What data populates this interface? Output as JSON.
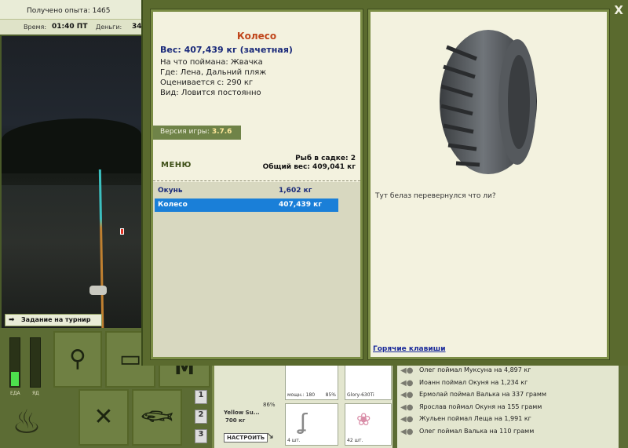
{
  "top": {
    "xp_label": "Получено опыта: 1465",
    "time_label": "Время:",
    "time_value": "01:40 ПТ",
    "money_label": "Деньги:",
    "money_value": "34"
  },
  "scene": {
    "task_button": "Задание на турнир"
  },
  "gauges": {
    "food_label": "ЕДА",
    "poison_label": "ЯД",
    "food_level": 0.3,
    "poison_level": 0
  },
  "inventory": {
    "slot_numbers": [
      "1",
      "2",
      "3"
    ],
    "rod_name": "Yellow Su...",
    "rod_weight": "700 кг",
    "rod_percent": "86%",
    "reel_power": "мощн.: 180",
    "reel_percent": "85%",
    "line_name": "Glory-630Ti",
    "hook_count": "4 шт.",
    "bait_count": "42 шт.",
    "setup_button": "НАСТРОИТЬ"
  },
  "news": [
    "Олег поймал Муксуна на 4,897 кг",
    "Иоанн поймал Окуня на 1,234 кг",
    "Ермолай поймал Валька на 337 грамм",
    "Ярослав поймал Окуня на 155 грамм",
    "Жульен поймал Леща на 1,991 кг",
    "Олег поймал Валька на 110 грамм"
  ],
  "modal": {
    "close_label": "X",
    "fish_name": "Колесо",
    "fish_weight": "Вес: 407,439 кг (зачетная)",
    "caught_on": "На что поймана: Жвачка",
    "where": "Где: Лена, Дальний пляж",
    "valued_from": "Оценивается с: 290 кг",
    "kind": "Вид: Ловится постоянно",
    "version_label": "Версия игры:",
    "version_value": "3.7.6",
    "menu_label": "МЕНЮ",
    "fish_in_net": "Рыб в садке: 2",
    "total_weight": "Общий вес: 409,041 кг",
    "catch_list": [
      {
        "name": "Окунь",
        "weight": "1,602 кг"
      },
      {
        "name": "Колесо",
        "weight": "407,439 кг"
      }
    ],
    "comment": "Тут белаз перевернулся что ли?",
    "hotkeys_link": "Горячие клавиши"
  },
  "colors": {
    "accent_title": "#c0461b",
    "selection": "#1a7fd8",
    "panel_border": "#7b8d46"
  }
}
